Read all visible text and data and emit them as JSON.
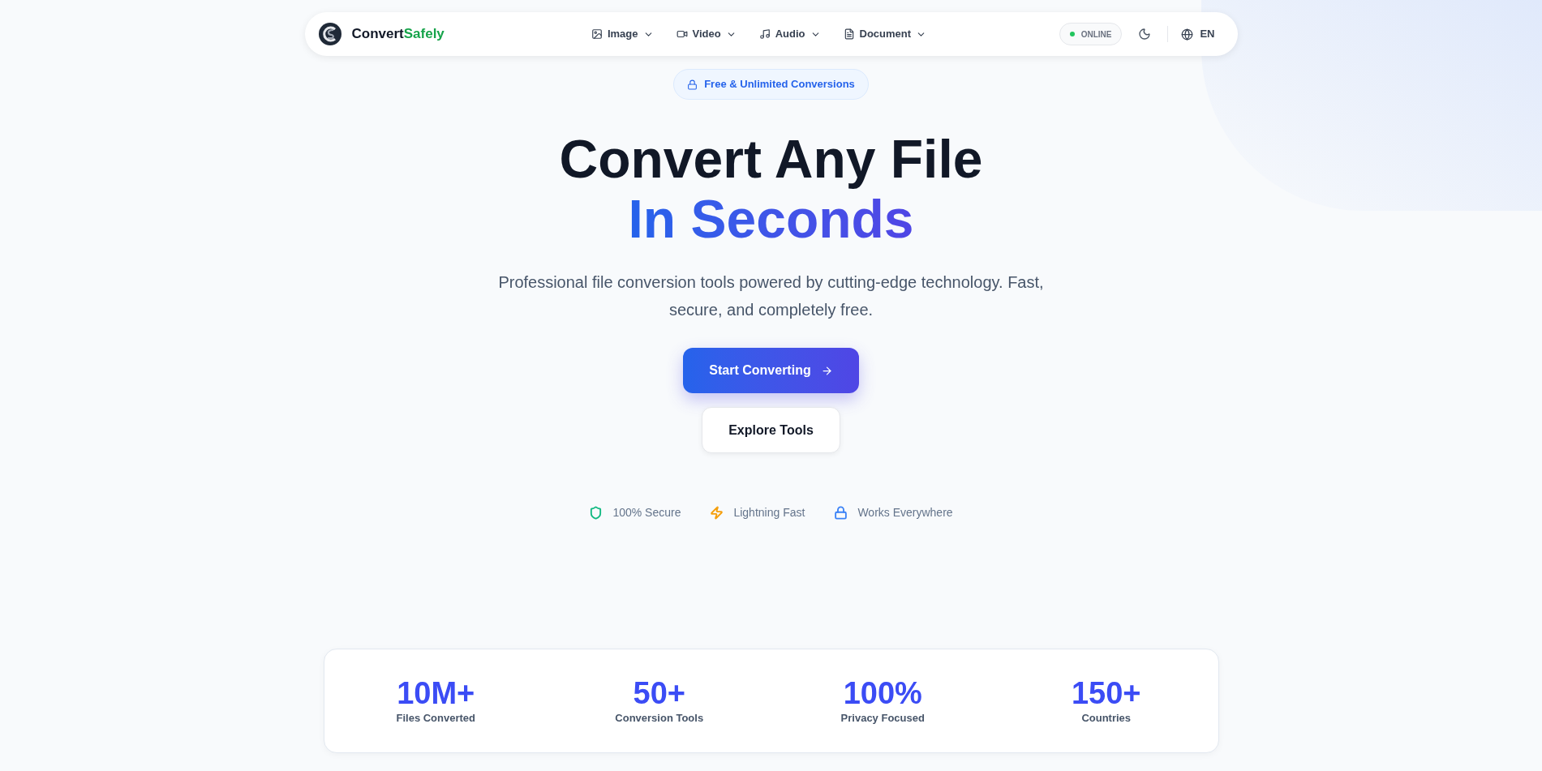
{
  "navbar": {
    "brand_main": "Convert",
    "brand_accent": "Safely",
    "menus": [
      {
        "label": "Image"
      },
      {
        "label": "Video"
      },
      {
        "label": "Audio"
      },
      {
        "label": "Document"
      }
    ],
    "status": {
      "label": "ONLINE",
      "online": true
    },
    "language": "EN"
  },
  "hero": {
    "badge": "Free & Unlimited Conversions",
    "title_line_1": "Convert Any File",
    "title_line_2": "In Seconds",
    "subtitle": "Professional file conversion tools powered by cutting-edge technology. Fast, secure, and completely free.",
    "primary_button": "Start Converting",
    "secondary_button": "Explore Tools",
    "features": [
      {
        "kind": "shield",
        "label": "100% Secure",
        "color": "#10b981"
      },
      {
        "kind": "bolt",
        "label": "Lightning Fast",
        "color": "#f59e0b"
      },
      {
        "kind": "lock",
        "label": "Works Everywhere",
        "color": "#3b82f6"
      }
    ]
  },
  "stats": [
    {
      "value": "10M+",
      "label": "Files Converted"
    },
    {
      "value": "50+",
      "label": "Conversion Tools"
    },
    {
      "value": "100%",
      "label": "Privacy Focused"
    },
    {
      "value": "150+",
      "label": "Countries"
    }
  ]
}
